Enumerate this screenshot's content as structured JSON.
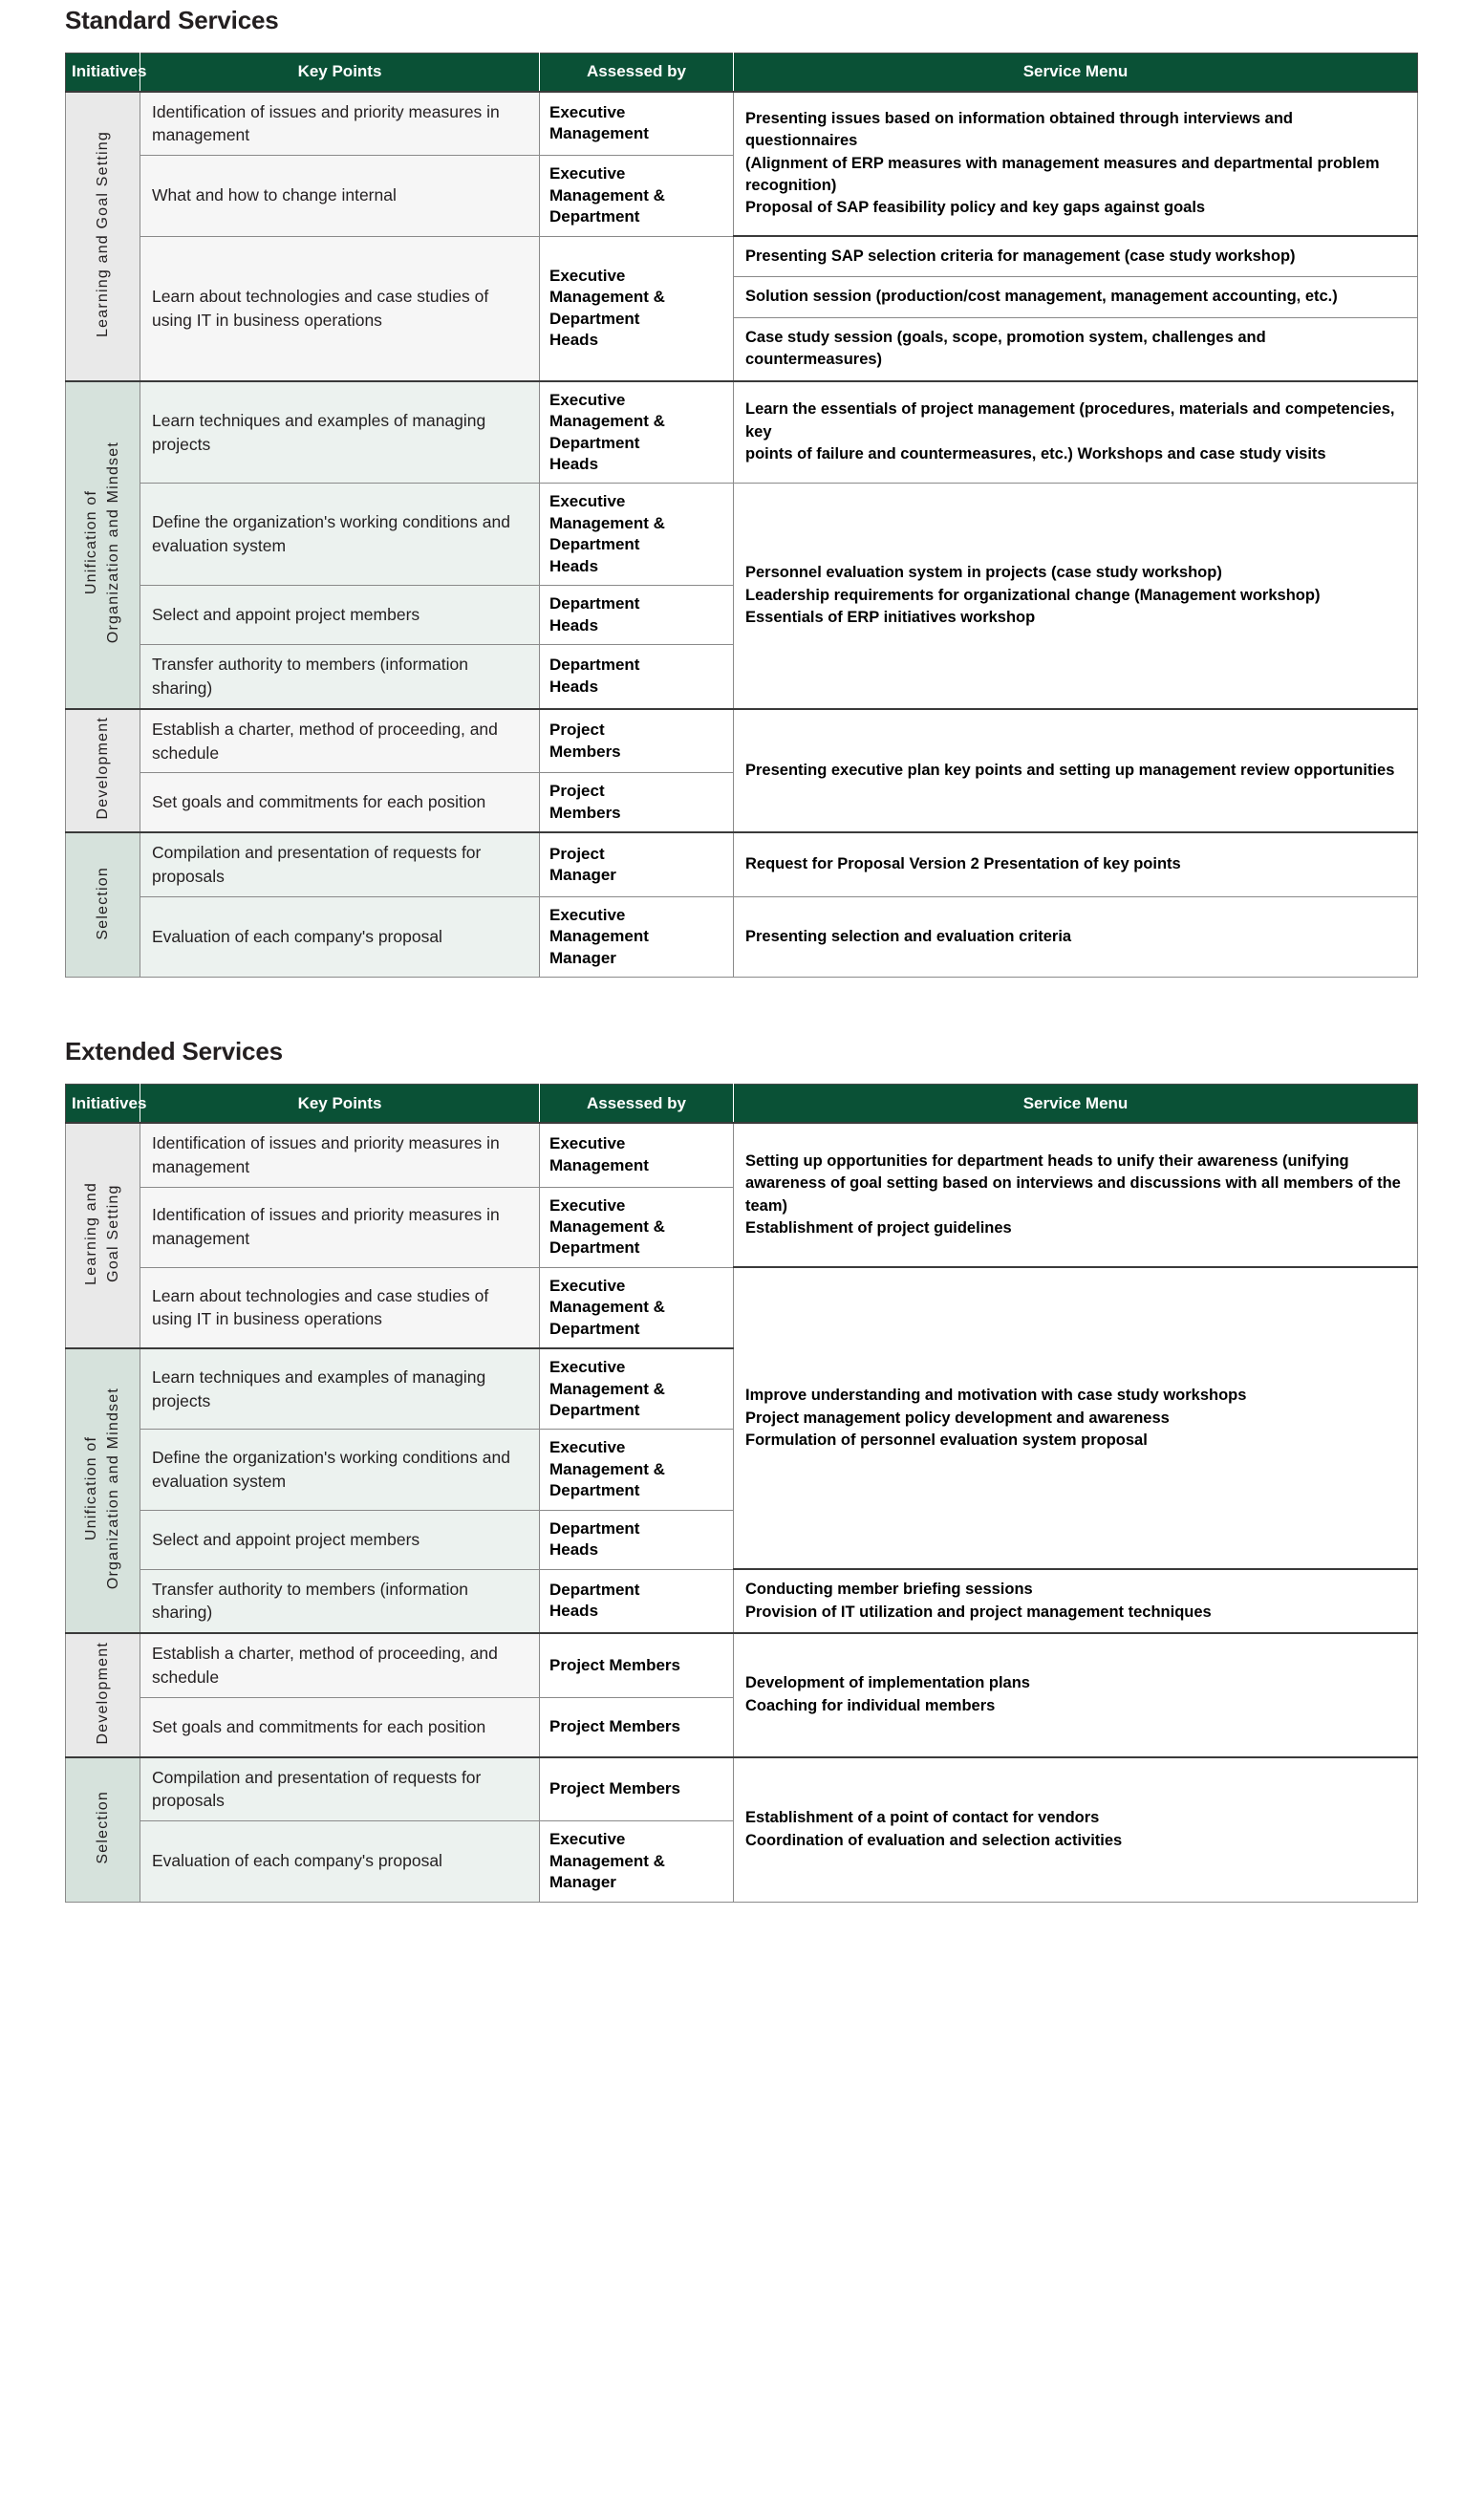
{
  "colors": {
    "header_green": "#0a5136",
    "tint_gray_init": "#e9e9e9",
    "tint_gray_body": "#f6f6f6",
    "tint_green_init": "#d6e2dc",
    "tint_green_body": "#ecf2ef",
    "text": "#231f20"
  },
  "columns": {
    "initiatives": "Initiatives",
    "key_points": "Key Points",
    "assessed_by": "Assessed by",
    "service_menu": "Service Menu"
  },
  "standard": {
    "title": "Standard Services",
    "rows": [
      {
        "initiative": "Learning and Goal Setting",
        "key": "Identification of issues and priority measures in management",
        "assessed": "Executive\nManagement",
        "menu": "Presenting issues based on information obtained through interviews and questionnaires\n(Alignment of ERP measures with management measures and departmental problem\nrecognition)\nProposal of SAP feasibility policy and key gaps against goals"
      },
      {
        "key": "What and how to change internal",
        "assessed": "Executive\nManagement &\nDepartment"
      },
      {
        "key": "Learn about technologies and case studies of using IT in business operations",
        "assessed": "Executive\nManagement &\nDepartment\nHeads",
        "menu": "Presenting SAP selection criteria for management (case study workshop)"
      },
      {
        "menu": "Solution session (production/cost management, management accounting, etc.)"
      },
      {
        "menu": "Case study session (goals, scope, promotion system, challenges and countermeasures)"
      },
      {
        "initiative": "Unification of\nOrganization and Mindset",
        "key": "Learn techniques and examples of managing projects",
        "assessed": "Executive\nManagement &\nDepartment\nHeads",
        "menu": "Learn the essentials of project management (procedures, materials and competencies, key\npoints of failure and countermeasures, etc.) Workshops and case study visits"
      },
      {
        "key": "Define the organization's working conditions and evaluation system",
        "assessed": "Executive\nManagement &\nDepartment\nHeads",
        "menu": "Personnel evaluation system in projects (case study workshop)\nLeadership requirements for organizational change (Management workshop)\nEssentials of ERP initiatives workshop"
      },
      {
        "key": "Select and appoint project members",
        "assessed": "Department\nHeads"
      },
      {
        "key": "Transfer authority to members (information sharing)",
        "assessed": "Department\nHeads"
      },
      {
        "initiative": "Development",
        "key": "Establish a charter, method of proceeding, and schedule",
        "assessed": "Project\nMembers",
        "menu": "Presenting executive plan key points and setting up management review opportunities"
      },
      {
        "key": "Set goals and commitments for each position",
        "assessed": "Project\nMembers"
      },
      {
        "initiative": "Selection",
        "key": "Compilation and presentation of requests for proposals",
        "assessed": "Project\nManager",
        "menu": "Request for Proposal Version 2 Presentation of key points"
      },
      {
        "key": "Evaluation of each company's proposal",
        "assessed": "Executive\nManagement\nManager",
        "menu": "Presenting selection and evaluation criteria"
      }
    ]
  },
  "extended": {
    "title": "Extended Services",
    "rows": [
      {
        "initiative": "Learning and\nGoal Setting",
        "key": "Identification of issues and priority measures in management",
        "assessed": "Executive\nManagement",
        "menu": "Setting up opportunities for department heads to unify their awareness (unifying awareness of goal setting based on interviews and discussions with all members of the team)\nEstablishment of project guidelines"
      },
      {
        "key": "Identification of issues and priority measures in management",
        "assessed": "Executive\nManagement &\nDepartment"
      },
      {
        "key": "Learn about technologies and case studies of using IT in business operations",
        "assessed": "Executive\nManagement &\nDepartment",
        "menu": "Improve understanding and motivation with case study workshops\nProject management policy development and awareness\nFormulation of personnel evaluation system proposal"
      },
      {
        "initiative": "Unification of\nOrganization and Mindset",
        "key": "Learn techniques and examples of managing projects",
        "assessed": "Executive\nManagement &\nDepartment"
      },
      {
        "key": "Define the organization's working conditions and evaluation system",
        "assessed": "Executive\nManagement &\nDepartment"
      },
      {
        "key": "Select and appoint project members",
        "assessed": "Department\nHeads"
      },
      {
        "key": "Transfer authority to members (information sharing)",
        "assessed": "Department\nHeads",
        "menu": "Conducting member briefing sessions\nProvision of IT utilization and project management techniques"
      },
      {
        "initiative": "Development",
        "key": "Establish a charter, method of proceeding, and schedule",
        "assessed": "Project Members",
        "menu": "Development of implementation plans\nCoaching for individual members"
      },
      {
        "key": "Set goals and commitments for each position",
        "assessed": "Project Members"
      },
      {
        "initiative": "Selection",
        "key": "Compilation and presentation of requests for proposals",
        "assessed": "Project Members",
        "menu": "Establishment of a point of contact for vendors\nCoordination of evaluation and selection activities"
      },
      {
        "key": "Evaluation of each company's proposal",
        "assessed": "Executive\nManagement &\nManager"
      }
    ]
  }
}
